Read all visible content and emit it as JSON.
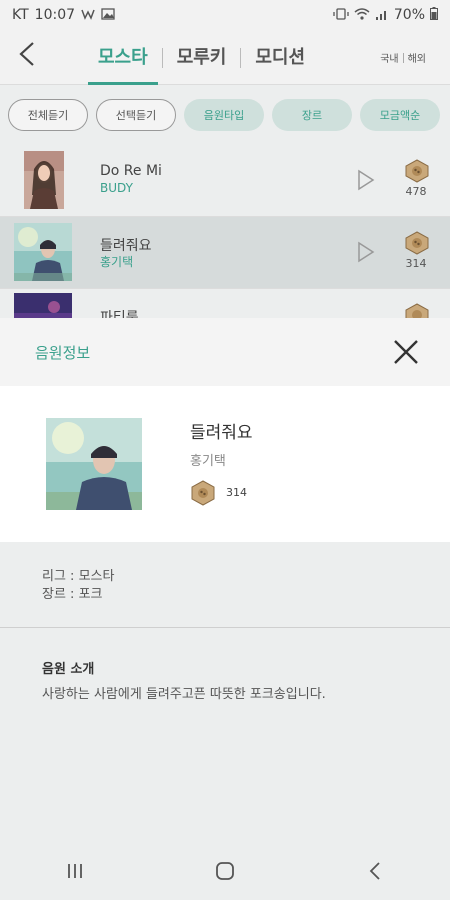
{
  "status": {
    "carrier": "KT",
    "time": "10:07",
    "battery": "70%",
    "icons": [
      "ktalk-icon",
      "gallery-icon",
      "vibrate-icon",
      "wifi-icon",
      "signal-icon",
      "battery-icon"
    ]
  },
  "header": {
    "tabs": [
      "모스타",
      "모루키",
      "모디션"
    ],
    "active_tab": 0,
    "region": [
      "국내",
      "해외"
    ]
  },
  "filters": {
    "all_play": "전체듣기",
    "select_play": "선택듣기",
    "sound_type": "음원타입",
    "genre": "장르",
    "fund_order": "모금액순"
  },
  "songs": [
    {
      "title": "Do Re Mi",
      "artist": "BUDY",
      "count": "478"
    },
    {
      "title": "들려줘요",
      "artist": "홍기택",
      "count": "314"
    },
    {
      "title": "파티룸",
      "artist": "",
      "count": ""
    }
  ],
  "sheet": {
    "title": "음원정보",
    "song_title": "들려줘요",
    "song_artist": "홍기택",
    "count": "314",
    "league_line": "리그 : 모스타",
    "genre_line": "장르 : 포크",
    "intro_heading": "음원 소개",
    "intro_body": "사랑하는 사람에게 들려주고픈 따뜻한 포크송입니다."
  },
  "colors": {
    "accent": "#3aa08c",
    "chip_fill": "#cfe0dc",
    "background": "#eceeee"
  }
}
